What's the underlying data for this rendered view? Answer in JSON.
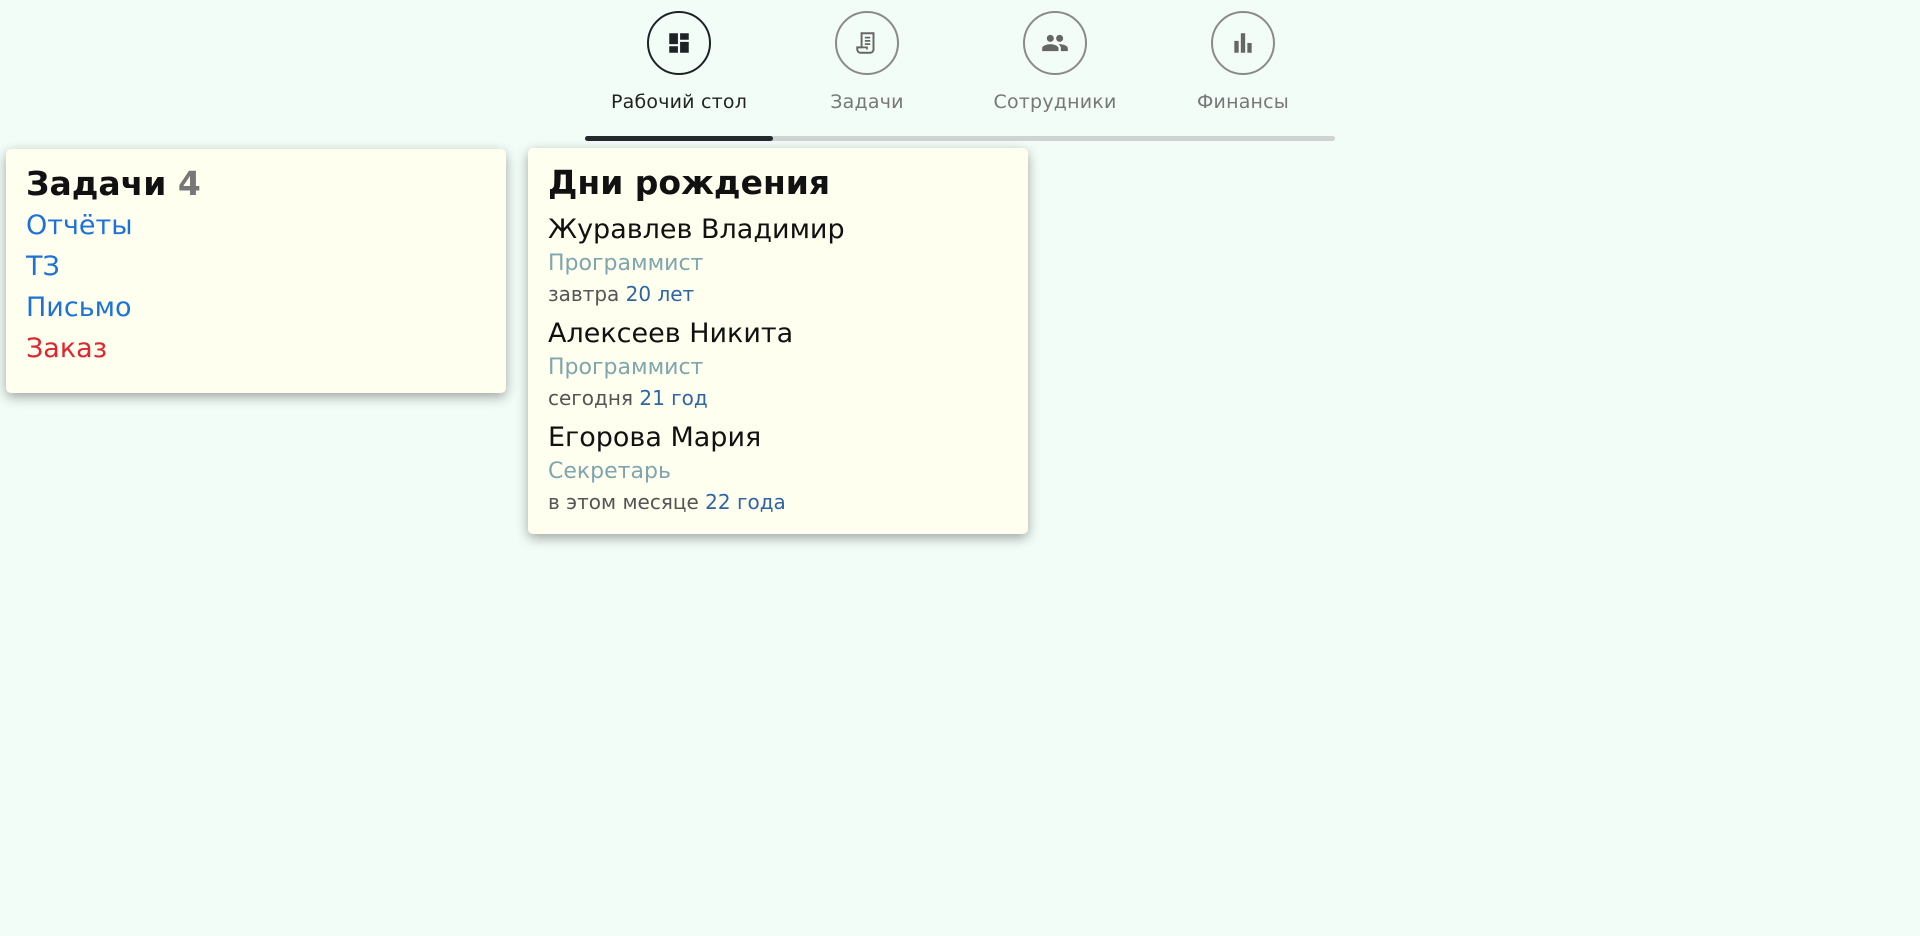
{
  "nav": {
    "items": [
      {
        "label": "Рабочий стол",
        "icon": "dashboard-icon"
      },
      {
        "label": "Задачи",
        "icon": "document-icon"
      },
      {
        "label": "Сотрудники",
        "icon": "people-icon"
      },
      {
        "label": "Финансы",
        "icon": "bar-chart-icon"
      }
    ],
    "active_index": 0
  },
  "tasks": {
    "title": "Задачи",
    "count": "4",
    "items": [
      {
        "label": "Отчёты"
      },
      {
        "label": "ТЗ"
      },
      {
        "label": "Письмо"
      },
      {
        "label": "Заказ"
      }
    ]
  },
  "birthdays": {
    "title": "Дни рождения",
    "people": [
      {
        "name": "Журавлев Владимир",
        "role": "Программист",
        "when": "завтра",
        "age": "20 лет"
      },
      {
        "name": "Алексеев Никита",
        "role": "Программист",
        "when": "сегодня",
        "age": "21 год"
      },
      {
        "name": "Егорова Мария",
        "role": "Секретарь",
        "when": "в этом месяце",
        "age": "22 года"
      }
    ]
  },
  "colors": {
    "background": "#f3fdf8",
    "card": "#fffff0",
    "link": "#1d72d8",
    "urgent": "#e0252e",
    "role": "#7fa6ad",
    "age": "#2f64a5"
  }
}
